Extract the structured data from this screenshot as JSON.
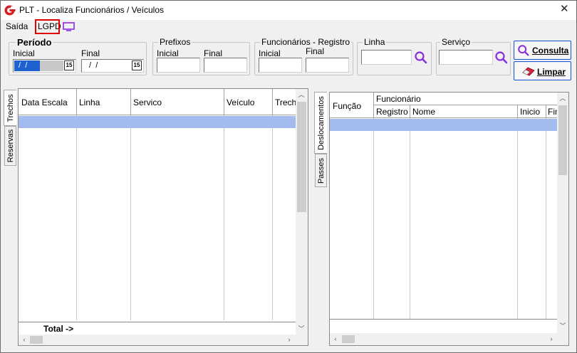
{
  "window": {
    "title": "PLT - Localiza Funcionários / Veículos",
    "close_glyph": "✕"
  },
  "menu": {
    "items": [
      "Saída",
      "LGPD"
    ],
    "monitor_icon": "monitor-icon"
  },
  "filters": {
    "periodo": {
      "legend": "Período",
      "inicial_label": "Inicial",
      "inicial_value": " /  /",
      "final_label": "Final",
      "final_value": " /  /",
      "calendar_glyph": "15"
    },
    "prefixos": {
      "legend": "Prefixos",
      "inicial_label": "Inicial",
      "final_label": "Final"
    },
    "funcionarios": {
      "legend": "Funcionários - Registro",
      "inicial_label": "Inicial",
      "final_label": "Final"
    },
    "linha": {
      "legend": "Linha"
    },
    "servico": {
      "legend": "Serviço"
    }
  },
  "buttons": {
    "consulta": "Consulta",
    "limpar": "Limpar"
  },
  "colors": {
    "accent": "#1e55c8",
    "selected_row": "#a4bbef",
    "search_icon": "#8a2be2",
    "highlight_box": "#e00000"
  },
  "left_tabs": [
    "Trechos",
    "Reservas"
  ],
  "left_table": {
    "columns": [
      "Data Escala",
      "Linha",
      "Servico",
      "Veículo",
      "Trecho"
    ],
    "total_label": "Total ->"
  },
  "right_tabs": [
    "Deslocamentos",
    "Passes"
  ],
  "right_table": {
    "funcao_header": "Função",
    "group_header": "Funcionário",
    "sub_columns": [
      "Registro",
      "Nome",
      "Inicio",
      "Fim"
    ]
  }
}
